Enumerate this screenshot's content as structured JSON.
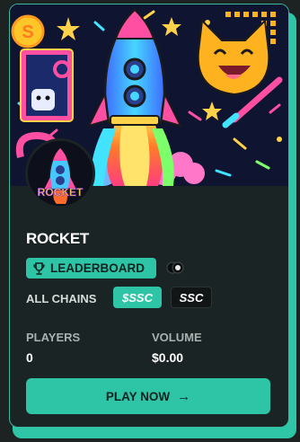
{
  "game": {
    "title": "ROCKET"
  },
  "leaderboard": {
    "label": "LEADERBOARD"
  },
  "chains": {
    "label": "ALL CHAINS",
    "options": [
      {
        "label": "$SSC",
        "active": true
      },
      {
        "label": "SSC",
        "active": false
      }
    ]
  },
  "stats": {
    "players": {
      "label": "PLAYERS",
      "value": "0"
    },
    "volume": {
      "label": "VOLUME",
      "value": "$0.00"
    }
  },
  "play_button": {
    "label": "PLAY NOW",
    "arrow": "→"
  },
  "avatar_text": "ROCKET",
  "coin_symbol": "S",
  "colors": {
    "accent": "#2ec4a6",
    "card_bg": "#1b2424",
    "page_bg": "#1c2322"
  }
}
